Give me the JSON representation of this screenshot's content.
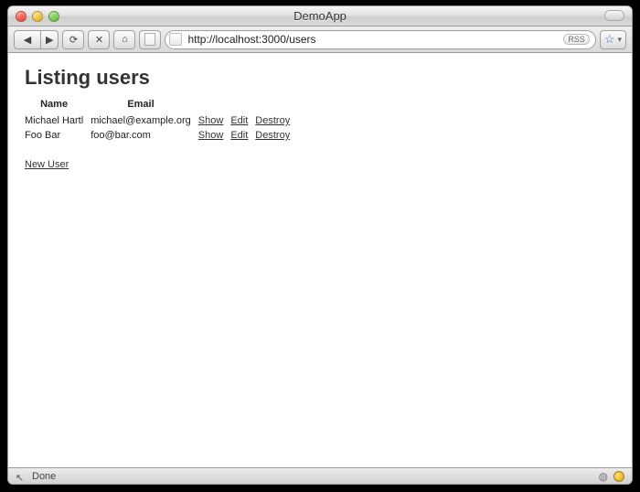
{
  "window": {
    "title": "DemoApp"
  },
  "toolbar": {
    "back_glyph": "◀",
    "fwd_glyph": "▶",
    "reload_glyph": "⟳",
    "stop_glyph": "✕",
    "home_glyph": "⌂",
    "rss_label": "RSS",
    "url": "http://localhost:3000/users",
    "star_glyph": "☆",
    "chev_glyph": "▾"
  },
  "page": {
    "heading": "Listing users",
    "columns": {
      "name": "Name",
      "email": "Email"
    },
    "actions": {
      "show": "Show",
      "edit": "Edit",
      "destroy": "Destroy"
    },
    "rows": [
      {
        "name": "Michael Hartl",
        "email": "michael@example.org"
      },
      {
        "name": "Foo Bar",
        "email": "foo@bar.com"
      }
    ],
    "new_user": "New User"
  },
  "status": {
    "done": "Done",
    "cursor_glyph": "↖"
  }
}
